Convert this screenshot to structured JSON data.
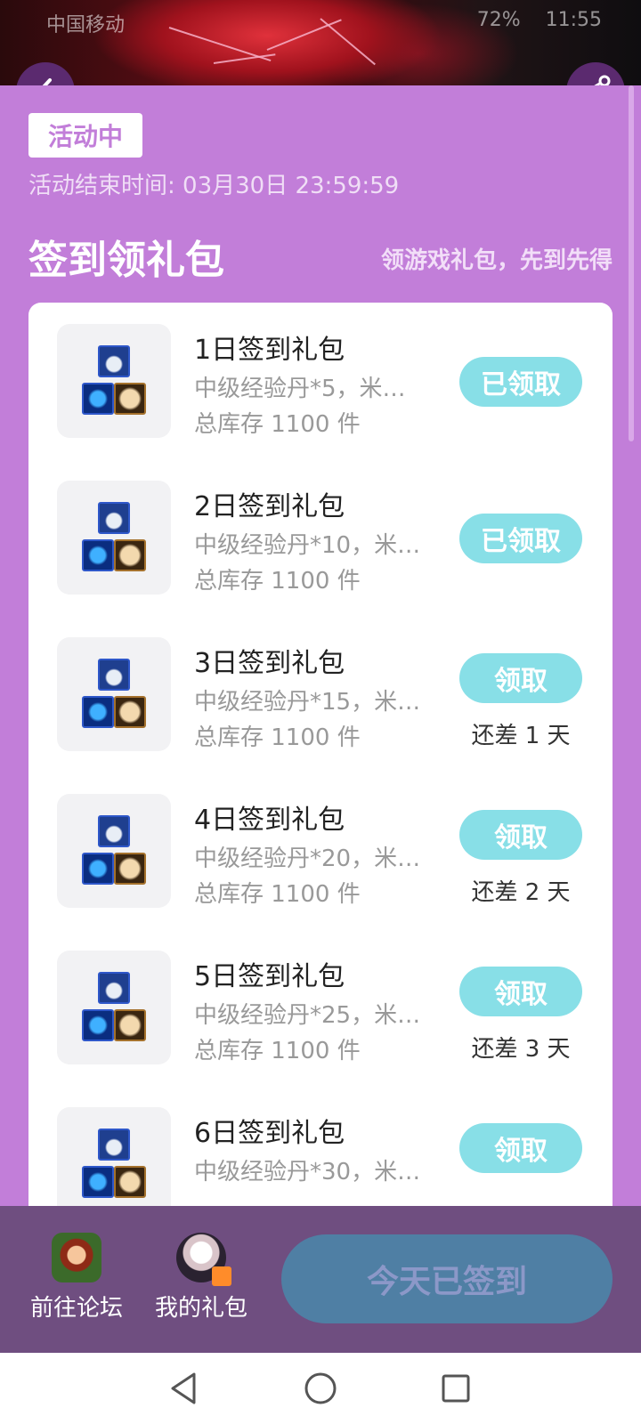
{
  "status_bar": {
    "carrier": "中国移动",
    "battery": "72%",
    "time": "11:55"
  },
  "header": {
    "back_icon": "chevron-left-icon",
    "share_icon": "share-icon"
  },
  "activity": {
    "tag": "活动中",
    "end_time": "活动结束时间: 03月30日 23:59:59"
  },
  "section": {
    "title": "签到领礼包",
    "subtitle": "领游戏礼包，先到先得"
  },
  "packs": [
    {
      "name": "1日签到礼包",
      "desc": "中级经验丹*5，米…",
      "stock": "总库存 1100 件",
      "button": "已领取",
      "remain": ""
    },
    {
      "name": "2日签到礼包",
      "desc": "中级经验丹*10，米…",
      "stock": "总库存 1100 件",
      "button": "已领取",
      "remain": ""
    },
    {
      "name": "3日签到礼包",
      "desc": "中级经验丹*15，米…",
      "stock": "总库存 1100 件",
      "button": "领取",
      "remain": "还差 1 天"
    },
    {
      "name": "4日签到礼包",
      "desc": "中级经验丹*20，米…",
      "stock": "总库存 1100 件",
      "button": "领取",
      "remain": "还差 2 天"
    },
    {
      "name": "5日签到礼包",
      "desc": "中级经验丹*25，米…",
      "stock": "总库存 1100 件",
      "button": "领取",
      "remain": "还差 3 天"
    },
    {
      "name": "6日签到礼包",
      "desc": "中级经验丹*30，米…",
      "stock": "",
      "button": "领取",
      "remain": ""
    }
  ],
  "bottom_bar": {
    "forum_label": "前往论坛",
    "gifts_label": "我的礼包",
    "sign_button": "今天已签到"
  },
  "colors": {
    "background": "#c27ed9",
    "button": "#88dfe7",
    "bottom_bar": "#6f4e80",
    "sign_button": "#4f7fa4"
  }
}
